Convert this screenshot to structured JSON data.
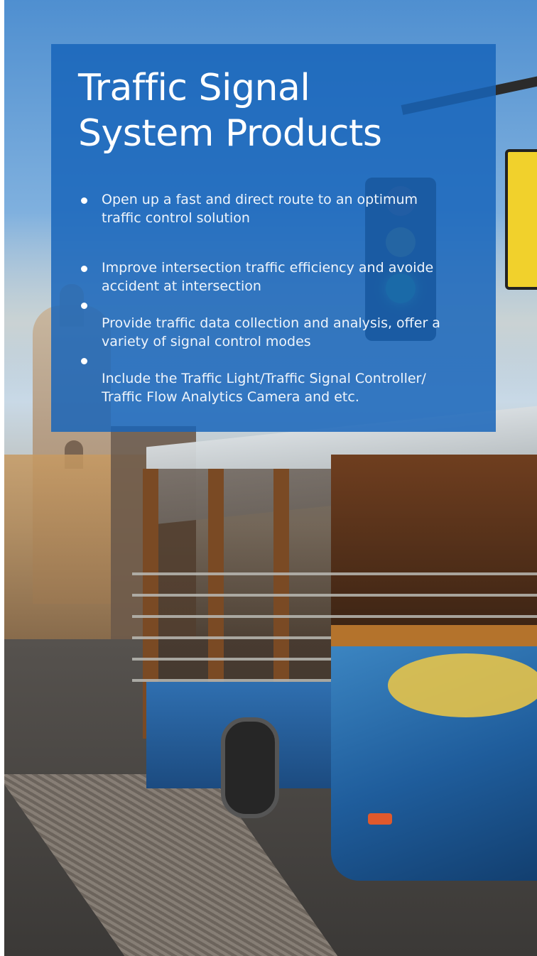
{
  "panel": {
    "title_line1": "Traffic Signal",
    "title_line2": "System Products",
    "bullets": [
      {
        "line1": "Open up a fast and direct route to an optimum",
        "line2": "traffic control solution"
      },
      {
        "line1": "Improve intersection traffic efficiency and avoide",
        "line2": "accident at intersection"
      },
      {
        "line1": "Provide traffic data collection and analysis, offer a",
        "line2": "variety of signal control modes"
      },
      {
        "line1": "Include the Traffic Light/Traffic Signal Controller/",
        "line2": "Traffic Flow Analytics Camera and etc."
      }
    ]
  },
  "colors": {
    "panel_background": "#1764BA",
    "text": "#FFFFFF"
  },
  "icons": {
    "bullet": "bullet-dot-icon"
  }
}
